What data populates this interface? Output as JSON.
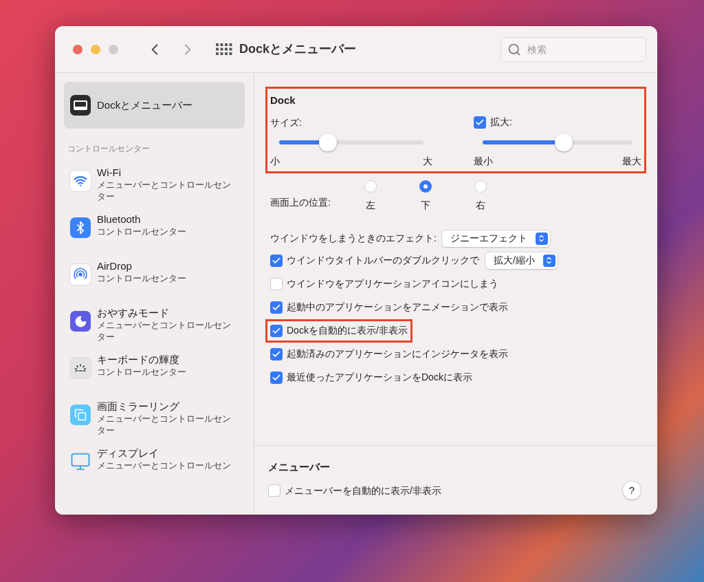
{
  "window": {
    "title": "Dockとメニューバー",
    "search": {
      "placeholder": "検索"
    }
  },
  "sidebar": {
    "selected_item": {
      "label": "Dockとメニューバー",
      "selected": true
    },
    "section_header": "コントロールセンター",
    "items": [
      {
        "kind": "wifi",
        "title": "Wi-Fi",
        "subtitle": "メニューバーとコントロールセンター",
        "selected": false
      },
      {
        "kind": "bluetooth",
        "title": "Bluetooth",
        "subtitle": "コントロールセンター",
        "selected": false
      },
      {
        "kind": "airdrop",
        "title": "AirDrop",
        "subtitle": "コントロールセンター",
        "selected": false
      },
      {
        "kind": "focus",
        "title": "おやすみモード",
        "subtitle": "メニューバーとコントロールセンター",
        "selected": false
      },
      {
        "kind": "keyboard",
        "title": "キーボードの輝度",
        "subtitle": "コントロールセンター",
        "selected": false
      },
      {
        "kind": "mirroring",
        "title": "画面ミラーリング",
        "subtitle": "メニューバーとコントロールセンター",
        "selected": false
      },
      {
        "kind": "display",
        "title": "ディスプレイ",
        "subtitle": "メニューバーとコントロールセン",
        "selected": false
      }
    ]
  },
  "dock": {
    "heading": "Dock",
    "highlighted": true,
    "size": {
      "label": "サイズ:",
      "level": 0.34,
      "min_label": "小",
      "max_label": "大"
    },
    "magnification": {
      "label": "拡大:",
      "checked": true,
      "level": 0.54,
      "min_label": "最小",
      "max_label": "最大"
    },
    "position": {
      "label": "画面上の位置:",
      "options": [
        {
          "label": "左",
          "selected": false
        },
        {
          "label": "下",
          "selected": true
        },
        {
          "label": "右",
          "selected": false
        }
      ]
    },
    "minimize_effect": {
      "label": "ウインドウをしまうときのエフェクト:",
      "value": "ジニーエフェクト"
    },
    "options": [
      {
        "label": "ウインドウタイトルバーのダブルクリックで",
        "checked": true,
        "highlighted": false,
        "select": "拡大/縮小"
      },
      {
        "label": "ウインドウをアプリケーションアイコンにしまう",
        "checked": false,
        "highlighted": false
      },
      {
        "label": "起動中のアプリケーションをアニメーションで表示",
        "checked": true,
        "highlighted": false
      },
      {
        "label": "Dockを自動的に表示/非表示",
        "checked": true,
        "highlighted": true
      },
      {
        "label": "起動済みのアプリケーションにインジケータを表示",
        "checked": true,
        "highlighted": false
      },
      {
        "label": "最近使ったアプリケーションをDockに表示",
        "checked": true,
        "highlighted": false
      }
    ]
  },
  "menu_bar": {
    "heading": "メニューバー",
    "options": [
      {
        "label": "メニューバーを自動的に表示/非表示",
        "checked": false
      }
    ],
    "help": "?"
  }
}
